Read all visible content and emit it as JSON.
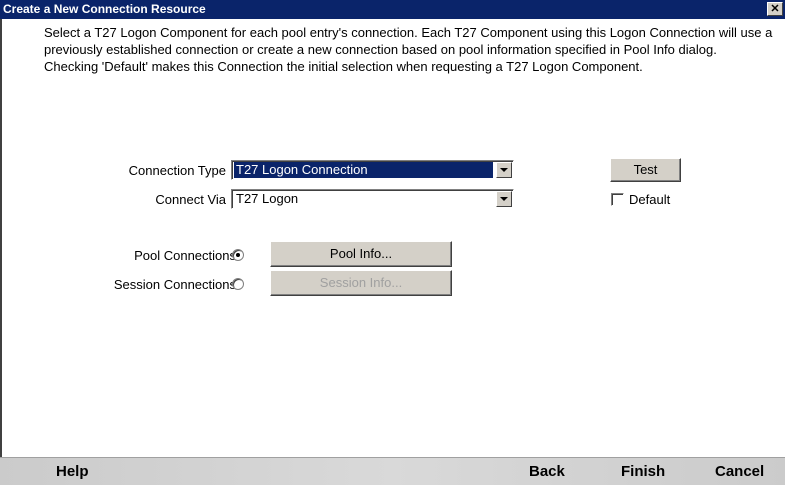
{
  "window": {
    "title": "Create a New Connection Resource",
    "close_glyph": "✕"
  },
  "description": "Select a T27 Logon Component for each pool entry's connection. Each T27 Component using this Logon Connection will use a previously established connection or create a new connection based on pool information specified in Pool Info dialog. Checking 'Default' makes this Connection the initial selection when requesting a T27 Logon Component.",
  "form": {
    "connection_type_label": "Connection Type",
    "connection_type_value": "T27 Logon Connection",
    "connect_via_label": "Connect Via",
    "connect_via_value": "T27 Logon",
    "test_button": "Test",
    "default_label": "Default",
    "default_checked": false,
    "pool_connections_label": "Pool Connections",
    "pool_connections_selected": true,
    "pool_info_button": "Pool Info...",
    "session_connections_label": "Session Connections",
    "session_connections_selected": false,
    "session_info_button": "Session Info..."
  },
  "footer": {
    "help": "Help",
    "back": "Back",
    "finish": "Finish",
    "cancel": "Cancel"
  },
  "colors": {
    "titlebar": "#0a246a",
    "selection": "#0a246a",
    "button_face": "#d4d0c8"
  },
  "icons": {
    "close": "close-icon",
    "dropdown": "chevron-down-icon"
  }
}
